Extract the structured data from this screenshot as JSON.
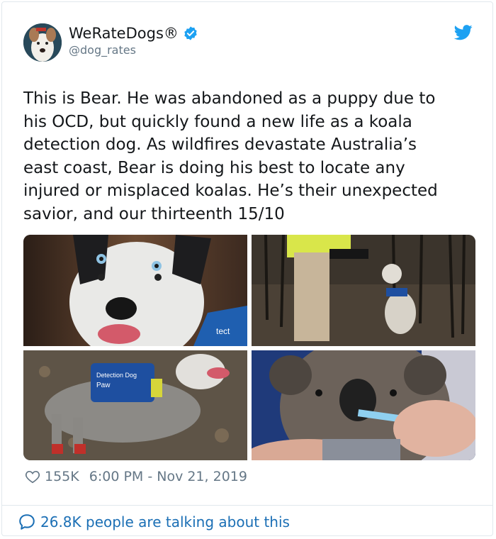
{
  "author": {
    "display_name": "WeRateDogs®",
    "handle": "@dog_rates"
  },
  "tweet": {
    "text": "This is Bear. He was abandoned as a puppy due to\nhis OCD, but quickly found a new life as a koala\ndetection dog. As wildfires devastate Australia’s\neast coast, Bear is doing his best to locate any\ninjured or misplaced koalas. He’s their unexpected\nsavior, and our thirteenth 15/10"
  },
  "media": {
    "vest_text": "Detection Dog",
    "vest_text_2": "Paw",
    "vest_patch": "tect"
  },
  "meta": {
    "likes": "155K",
    "timestamp": "6:00 PM - Nov 21, 2019"
  },
  "footer": {
    "talking": "26.8K people are talking about this"
  },
  "colors": {
    "twitter_blue": "#1da1f2",
    "link_blue": "#1b6fb5",
    "muted": "#657786",
    "text": "#14171a",
    "border": "#e1e8ed"
  },
  "icons": {
    "verified": "verified-badge-icon",
    "brand": "twitter-bird-icon",
    "like": "heart-icon",
    "reply": "speech-bubble-icon"
  }
}
